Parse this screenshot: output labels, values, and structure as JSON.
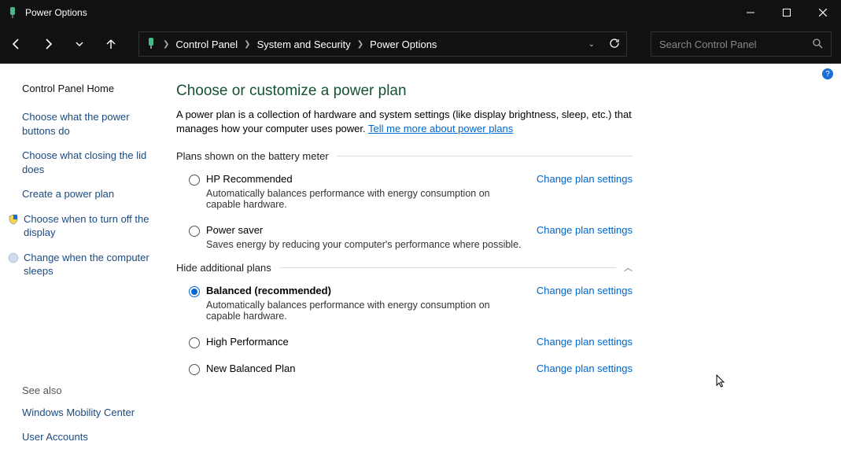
{
  "window": {
    "title": "Power Options"
  },
  "breadcrumb": {
    "root": "Control Panel",
    "mid": "System and Security",
    "leaf": "Power Options"
  },
  "search": {
    "placeholder": "Search Control Panel"
  },
  "sidebar": {
    "home": "Control Panel Home",
    "links": {
      "buttons": "Choose what the power buttons do",
      "lid": "Choose what closing the lid does",
      "create": "Create a power plan",
      "turnoff": "Choose when to turn off the display",
      "sleeps": "Change when the computer sleeps"
    },
    "see_also_hdr": "See also",
    "see_also": {
      "mobility": "Windows Mobility Center",
      "accounts": "User Accounts"
    }
  },
  "main": {
    "heading": "Choose or customize a power plan",
    "desc_line": "A power plan is a collection of hardware and system settings (like display brightness, sleep, etc.) that manages how your computer uses power. ",
    "desc_link": "Tell me more about power plans",
    "section_battery": "Plans shown on the battery meter",
    "section_hide": "Hide additional plans",
    "change_label": "Change plan settings",
    "plans": {
      "hp": {
        "name": "HP Recommended",
        "desc": "Automatically balances performance with energy consumption on capable hardware.",
        "selected": false
      },
      "ps": {
        "name": "Power saver",
        "desc": "Saves energy by reducing your computer's performance where possible.",
        "selected": false
      },
      "bal": {
        "name": "Balanced (recommended)",
        "desc": "Automatically balances performance with energy consumption on capable hardware.",
        "selected": true
      },
      "high": {
        "name": "High Performance",
        "desc": "",
        "selected": false
      },
      "new": {
        "name": "New Balanced Plan",
        "desc": "",
        "selected": false
      }
    }
  }
}
